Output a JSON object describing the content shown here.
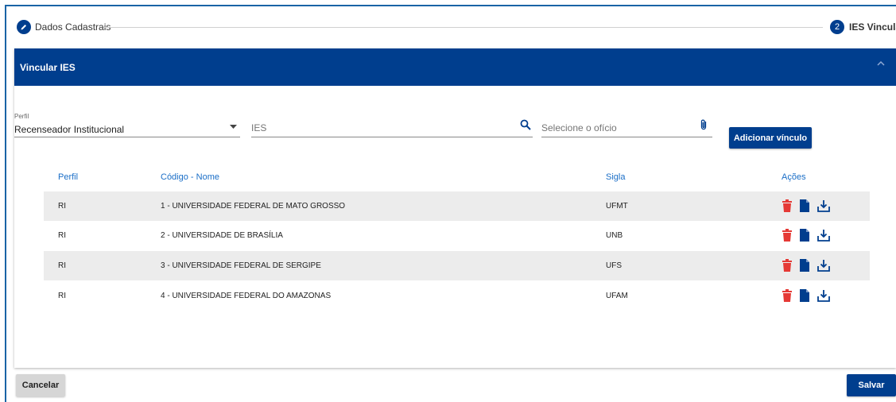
{
  "stepper": {
    "step1": {
      "number": "",
      "label": "Dados Cadastrais",
      "icon": "pencil-icon"
    },
    "step2": {
      "number": "2",
      "label": "IES Vinculada"
    }
  },
  "card": {
    "title": "Vincular IES",
    "collapse_icon": "chevron-up-icon"
  },
  "form": {
    "perfil_label": "Perfil",
    "perfil_value": "Recenseador Institucional",
    "ies_placeholder": "IES",
    "oficio_placeholder": "Selecione o ofício",
    "add_button": "Adicionar vínculo"
  },
  "table": {
    "headers": {
      "perfil": "Perfil",
      "nome": "Código - Nome",
      "sigla": "Sigla",
      "acoes": "Ações"
    },
    "rows": [
      {
        "perfil": "RI",
        "nome": "1 - UNIVERSIDADE FEDERAL DE MATO GROSSO",
        "sigla": "UFMT"
      },
      {
        "perfil": "RI",
        "nome": "2 - UNIVERSIDADE DE BRASÍLIA",
        "sigla": "UNB"
      },
      {
        "perfil": "RI",
        "nome": "3 - UNIVERSIDADE FEDERAL DE SERGIPE",
        "sigla": "UFS"
      },
      {
        "perfil": "RI",
        "nome": "4 - UNIVERSIDADE FEDERAL DO AMAZONAS",
        "sigla": "UFAM"
      }
    ],
    "action_icons": [
      "trash-icon",
      "document-icon",
      "download-icon"
    ]
  },
  "footer": {
    "cancel_label": "Cancelar",
    "save_label": "Salvar"
  },
  "colors": {
    "primary": "#003e8e",
    "header_text": "#1a6ec7",
    "delete": "#e53935",
    "row_stripe": "#ececec"
  }
}
